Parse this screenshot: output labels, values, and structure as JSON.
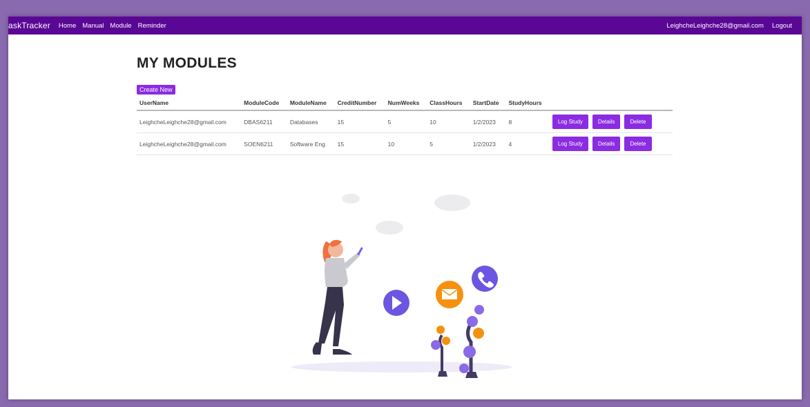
{
  "nav": {
    "brand": "askTracker",
    "links": [
      "Home",
      "Manual",
      "Module",
      "Reminder"
    ],
    "user_email": "LeighcheLeighche28@gmail.com",
    "logout": "Logout"
  },
  "page": {
    "title": "MY MODULES",
    "create_new": "Create New"
  },
  "table": {
    "headers": [
      "UserName",
      "ModuleCode",
      "ModuleName",
      "CreditNumber",
      "NumWeeks",
      "ClassHours",
      "StartDate",
      "StudyHours"
    ],
    "rows": [
      {
        "user": "LeighcheLeighche28@gmail.com",
        "code": "DBAS6211",
        "name": "Databases",
        "credits": "15",
        "weeks": "5",
        "class_hours": "10",
        "start": "1/2/2023",
        "study_hours": "8"
      },
      {
        "user": "LeighcheLeighche28@gmail.com",
        "code": "SOEN6211",
        "name": "Software Eng",
        "credits": "15",
        "weeks": "10",
        "class_hours": "5",
        "start": "1/2/2023",
        "study_hours": "4"
      }
    ],
    "actions": {
      "log_study": "Log Study",
      "details": "Details",
      "delete": "Delete"
    }
  },
  "colors": {
    "navbar": "#5a0796",
    "button": "#8b2be2",
    "background_frame": "#8a6aae",
    "accent_orange": "#f5910f",
    "accent_purple": "#6c55e0"
  },
  "illustration_icons": [
    "play-icon",
    "mail-icon",
    "phone-icon"
  ]
}
